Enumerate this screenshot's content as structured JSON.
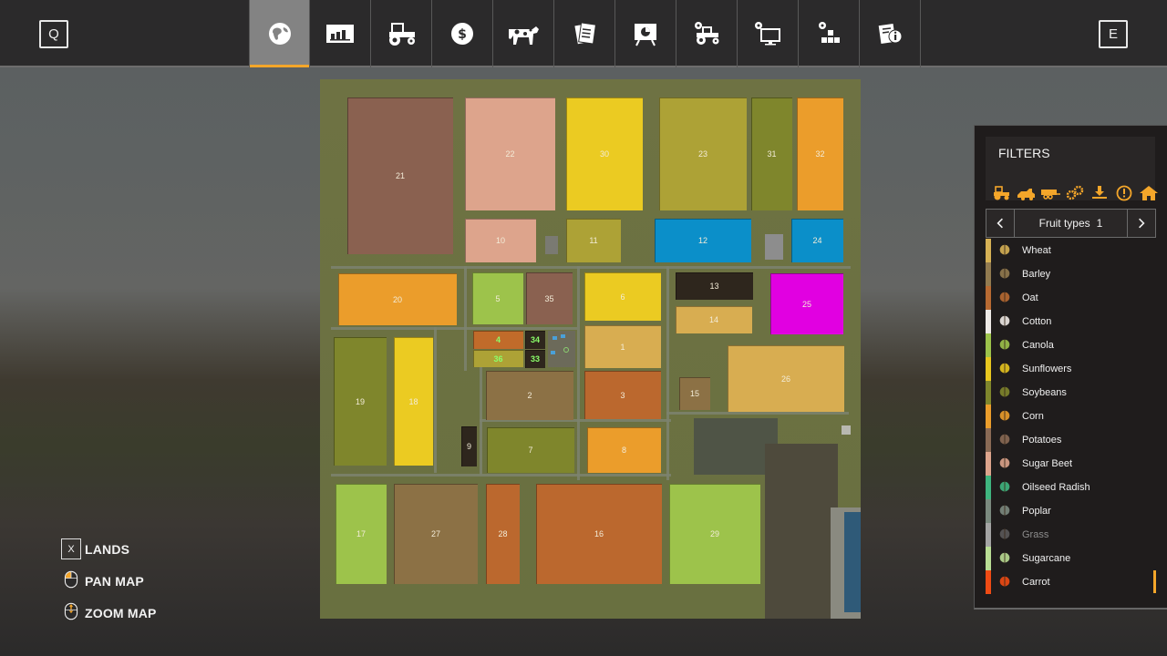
{
  "topbar": {
    "left_key": "Q",
    "right_key": "E",
    "tabs": [
      {
        "icon": "globe-icon",
        "label": "Map",
        "active": true
      },
      {
        "icon": "chart-icon",
        "label": "Statistics",
        "active": false
      },
      {
        "icon": "tractor-icon",
        "label": "Vehicles",
        "active": false
      },
      {
        "icon": "dollar-icon",
        "label": "Finances",
        "active": false
      },
      {
        "icon": "cow-icon",
        "label": "Animals",
        "active": false
      },
      {
        "icon": "contracts-icon",
        "label": "Contracts",
        "active": false
      },
      {
        "icon": "presentation-icon",
        "label": "Help",
        "active": false
      },
      {
        "icon": "tractor-gear-icon",
        "label": "Game Settings",
        "active": false
      },
      {
        "icon": "monitor-gear-icon",
        "label": "General Settings",
        "active": false
      },
      {
        "icon": "blocks-gear-icon",
        "label": "Controls",
        "active": false
      },
      {
        "icon": "info-doc-icon",
        "label": "Info",
        "active": false
      }
    ]
  },
  "map": {
    "fields": [
      {
        "id": "21",
        "color": "#8a6150"
      },
      {
        "id": "22",
        "color": "#dda48c"
      },
      {
        "id": "30",
        "color": "#ebcb22"
      },
      {
        "id": "23",
        "color": "#ada236"
      },
      {
        "id": "31",
        "color": "#7f862c"
      },
      {
        "id": "32",
        "color": "#eb9d2b"
      },
      {
        "id": "10",
        "color": "#dda48c"
      },
      {
        "id": "11",
        "color": "#ada236"
      },
      {
        "id": "12",
        "color": "#0b8fc9"
      },
      {
        "id": "24",
        "color": "#0b8fc9"
      },
      {
        "id": "20",
        "color": "#eb9d2b"
      },
      {
        "id": "5",
        "color": "#9dc34b"
      },
      {
        "id": "35",
        "color": "#8a6150"
      },
      {
        "id": "6",
        "color": "#ebcb22"
      },
      {
        "id": "13",
        "color": "#2e261d"
      },
      {
        "id": "25",
        "color": "#e100e1"
      },
      {
        "id": "14",
        "color": "#d8ad51"
      },
      {
        "id": "4",
        "color": "#c16b2a"
      },
      {
        "id": "34",
        "color": "#2e261d"
      },
      {
        "id": "36",
        "color": "#ada236"
      },
      {
        "id": "33",
        "color": "#2e261d"
      },
      {
        "id": "1",
        "color": "#d8ad51"
      },
      {
        "id": "19",
        "color": "#7f862c"
      },
      {
        "id": "18",
        "color": "#ebcb22"
      },
      {
        "id": "2",
        "color": "#8c7145"
      },
      {
        "id": "3",
        "color": "#bb682e"
      },
      {
        "id": "15",
        "color": "#8c7145"
      },
      {
        "id": "26",
        "color": "#d8ad51"
      },
      {
        "id": "9",
        "color": "#2e261d"
      },
      {
        "id": "7",
        "color": "#7f862c"
      },
      {
        "id": "8",
        "color": "#eb9d2b"
      },
      {
        "id": "17",
        "color": "#9dc34b"
      },
      {
        "id": "27",
        "color": "#8c7145"
      },
      {
        "id": "28",
        "color": "#bb682e"
      },
      {
        "id": "16",
        "color": "#bb682e"
      },
      {
        "id": "29",
        "color": "#9dc34b"
      }
    ]
  },
  "help": {
    "lands_key": "X",
    "lands_label": "LANDS",
    "pan_label": "PAN MAP",
    "zoom_label": "ZOOM MAP"
  },
  "filters": {
    "title": "FILTERS",
    "icons": [
      "tractor-icon",
      "harvester-icon",
      "trailer-icon",
      "gears-icon",
      "download-icon",
      "warning-icon",
      "home-icon"
    ],
    "accent": "#f4a62a",
    "selector_label": "Fruit types",
    "selector_page": "1",
    "items": [
      {
        "label": "Wheat",
        "color": "#d6b155",
        "icon": "wheat-icon",
        "enabled": true
      },
      {
        "label": "Barley",
        "color": "#927b50",
        "icon": "barley-icon",
        "enabled": true
      },
      {
        "label": "Oat",
        "color": "#b86a32",
        "icon": "oat-icon",
        "enabled": true
      },
      {
        "label": "Cotton",
        "color": "#eeeae6",
        "icon": "cotton-icon",
        "enabled": true
      },
      {
        "label": "Canola",
        "color": "#9dc34b",
        "icon": "canola-icon",
        "enabled": true
      },
      {
        "label": "Sunflowers",
        "color": "#e8c71f",
        "icon": "sunflower-icon",
        "enabled": true
      },
      {
        "label": "Soybeans",
        "color": "#7f862c",
        "icon": "soybean-icon",
        "enabled": true
      },
      {
        "label": "Corn",
        "color": "#eb9d2b",
        "icon": "corn-icon",
        "enabled": true
      },
      {
        "label": "Potatoes",
        "color": "#8a6a55",
        "icon": "potato-icon",
        "enabled": true
      },
      {
        "label": "Sugar Beet",
        "color": "#dda48c",
        "icon": "sugarbeet-icon",
        "enabled": true
      },
      {
        "label": "Oilseed Radish",
        "color": "#3fb57f",
        "icon": "radish-icon",
        "enabled": true
      },
      {
        "label": "Poplar",
        "color": "#7b8a7f",
        "icon": "poplar-icon",
        "enabled": true
      },
      {
        "label": "Grass",
        "color": "#a4a4a4",
        "icon": "grass-icon",
        "enabled": false
      },
      {
        "label": "Sugarcane",
        "color": "#b9dd94",
        "icon": "sugarcane-icon",
        "enabled": true
      },
      {
        "label": "Carrot",
        "color": "#ef4b14",
        "icon": "carrot-icon",
        "enabled": true
      }
    ]
  }
}
